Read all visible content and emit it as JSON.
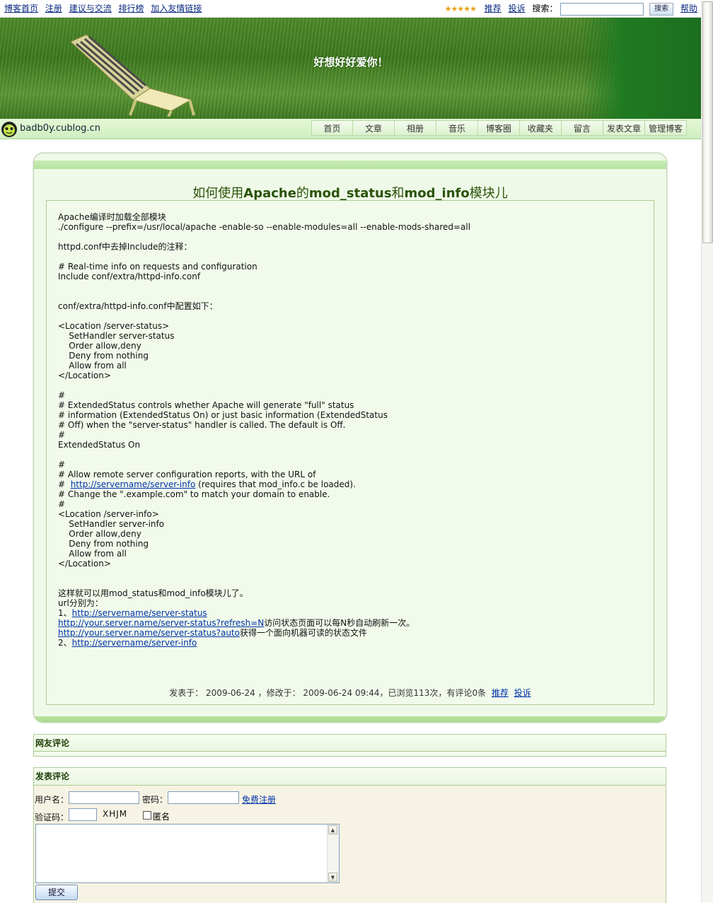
{
  "topbar": {
    "links": [
      "博客首页",
      "注册",
      "建议与交流",
      "排行榜",
      "加入友情链接"
    ],
    "stars": "★★★★★",
    "recommend": "推荐",
    "complain": "投诉",
    "search_label": "搜索：",
    "search_value": "",
    "search_button": "搜索",
    "help": "帮助"
  },
  "banner": {
    "title": "好想好好爱你！"
  },
  "nav": {
    "site_url": "badb0y.cublog.cn",
    "items": [
      "首页",
      "文章",
      "相册",
      "音乐",
      "博客圈",
      "收藏夹",
      "留言",
      "发表文章",
      "管理博客"
    ]
  },
  "article": {
    "title_parts": [
      "如何使用",
      "Apache",
      "的",
      "mod_status",
      "和",
      "mod_info",
      "模块儿"
    ],
    "body_lines": [
      "Apache编译时加载全部模块",
      "./configure --prefix=/usr/local/apache -enable-so --enable-modules=all --enable-mods-shared=all",
      "",
      "httpd.conf中去掉Include的注释：",
      "",
      "# Real-time info on requests and configuration",
      "Include conf/extra/httpd-info.conf",
      "",
      "",
      "conf/extra/httpd-info.conf中配置如下：",
      "",
      "<Location /server-status>",
      "    SetHandler server-status",
      "    Order allow,deny",
      "    Deny from nothing",
      "    Allow from all",
      "</Location>",
      "",
      "#",
      "# ExtendedStatus controls whether Apache will generate \"full\" status",
      "# information (ExtendedStatus On) or just basic information (ExtendedStatus",
      "# Off) when the \"server-status\" handler is called. The default is Off.",
      "#",
      "ExtendedStatus On",
      "",
      "#",
      "# Allow remote server configuration reports, with the URL of",
      "#  ",
      "# Change the \".example.com\" to match your domain to enable.",
      "#",
      "<Location /server-info>",
      "    SetHandler server-info",
      "    Order allow,deny",
      "    Deny from nothing",
      "    Allow from all",
      "</Location>",
      "",
      "",
      "这样就可以用mod_status和mod_info模块儿了。",
      "url分别为：",
      "1、",
      "",
      "",
      "2、"
    ],
    "link_server_info": "http://servername/server-info",
    "link_server_info_suffix": " (requires that mod_info.c be loaded).",
    "link_status": "http://servername/server-status",
    "link_refresh": "http://your.server.name/server-status?refresh=N",
    "link_refresh_suffix": "访问状态页面可以每N秒自动刷新一次。",
    "link_auto": "http://your.server.name/server-status?auto",
    "link_auto_suffix": "获得一个面向机器可读的状态文件",
    "link_info2": "http://servername/server-info",
    "meta_text": "发表于： 2009-06-24 ，修改于： 2009-06-24 09:44，已浏览113次，有评论0条",
    "meta_recommend": "推荐",
    "meta_complain": "投诉"
  },
  "comments": {
    "header": "网友评论"
  },
  "post_comment": {
    "header": "发表评论",
    "username_label": "用户名：",
    "username_value": "",
    "password_label": "密码：",
    "password_value": "",
    "register_link": "免费注册",
    "captcha_label": "验证码：",
    "captcha_value": "",
    "captcha_code": "XHJM",
    "anonymous_label": "匿名",
    "anonymous_checked": false,
    "comment_value": "",
    "submit_label": "提交"
  },
  "colors": {
    "link": "#0033aa",
    "title_green": "#2a5208",
    "panel_bg": "#eff9e8",
    "border_green": "#aecd94"
  }
}
